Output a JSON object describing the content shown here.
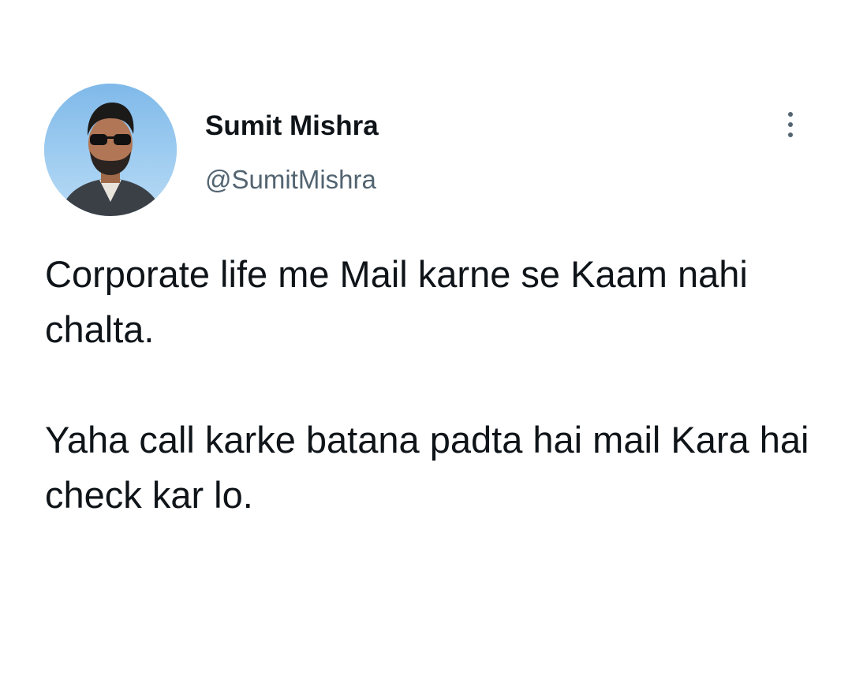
{
  "tweet": {
    "author": {
      "display_name": "Sumit Mishra",
      "handle": "@SumitMishra",
      "avatar_icon": "profile-photo"
    },
    "more_icon": "more-vertical-icon",
    "paragraphs": [
      "Corporate life me Mail karne se Kaam nahi chalta.",
      "Yaha call karke batana padta hai mail Kara hai check kar lo."
    ]
  },
  "colors": {
    "background": "#ffffff",
    "primary_text": "#0f1419",
    "secondary_text": "#536471"
  }
}
